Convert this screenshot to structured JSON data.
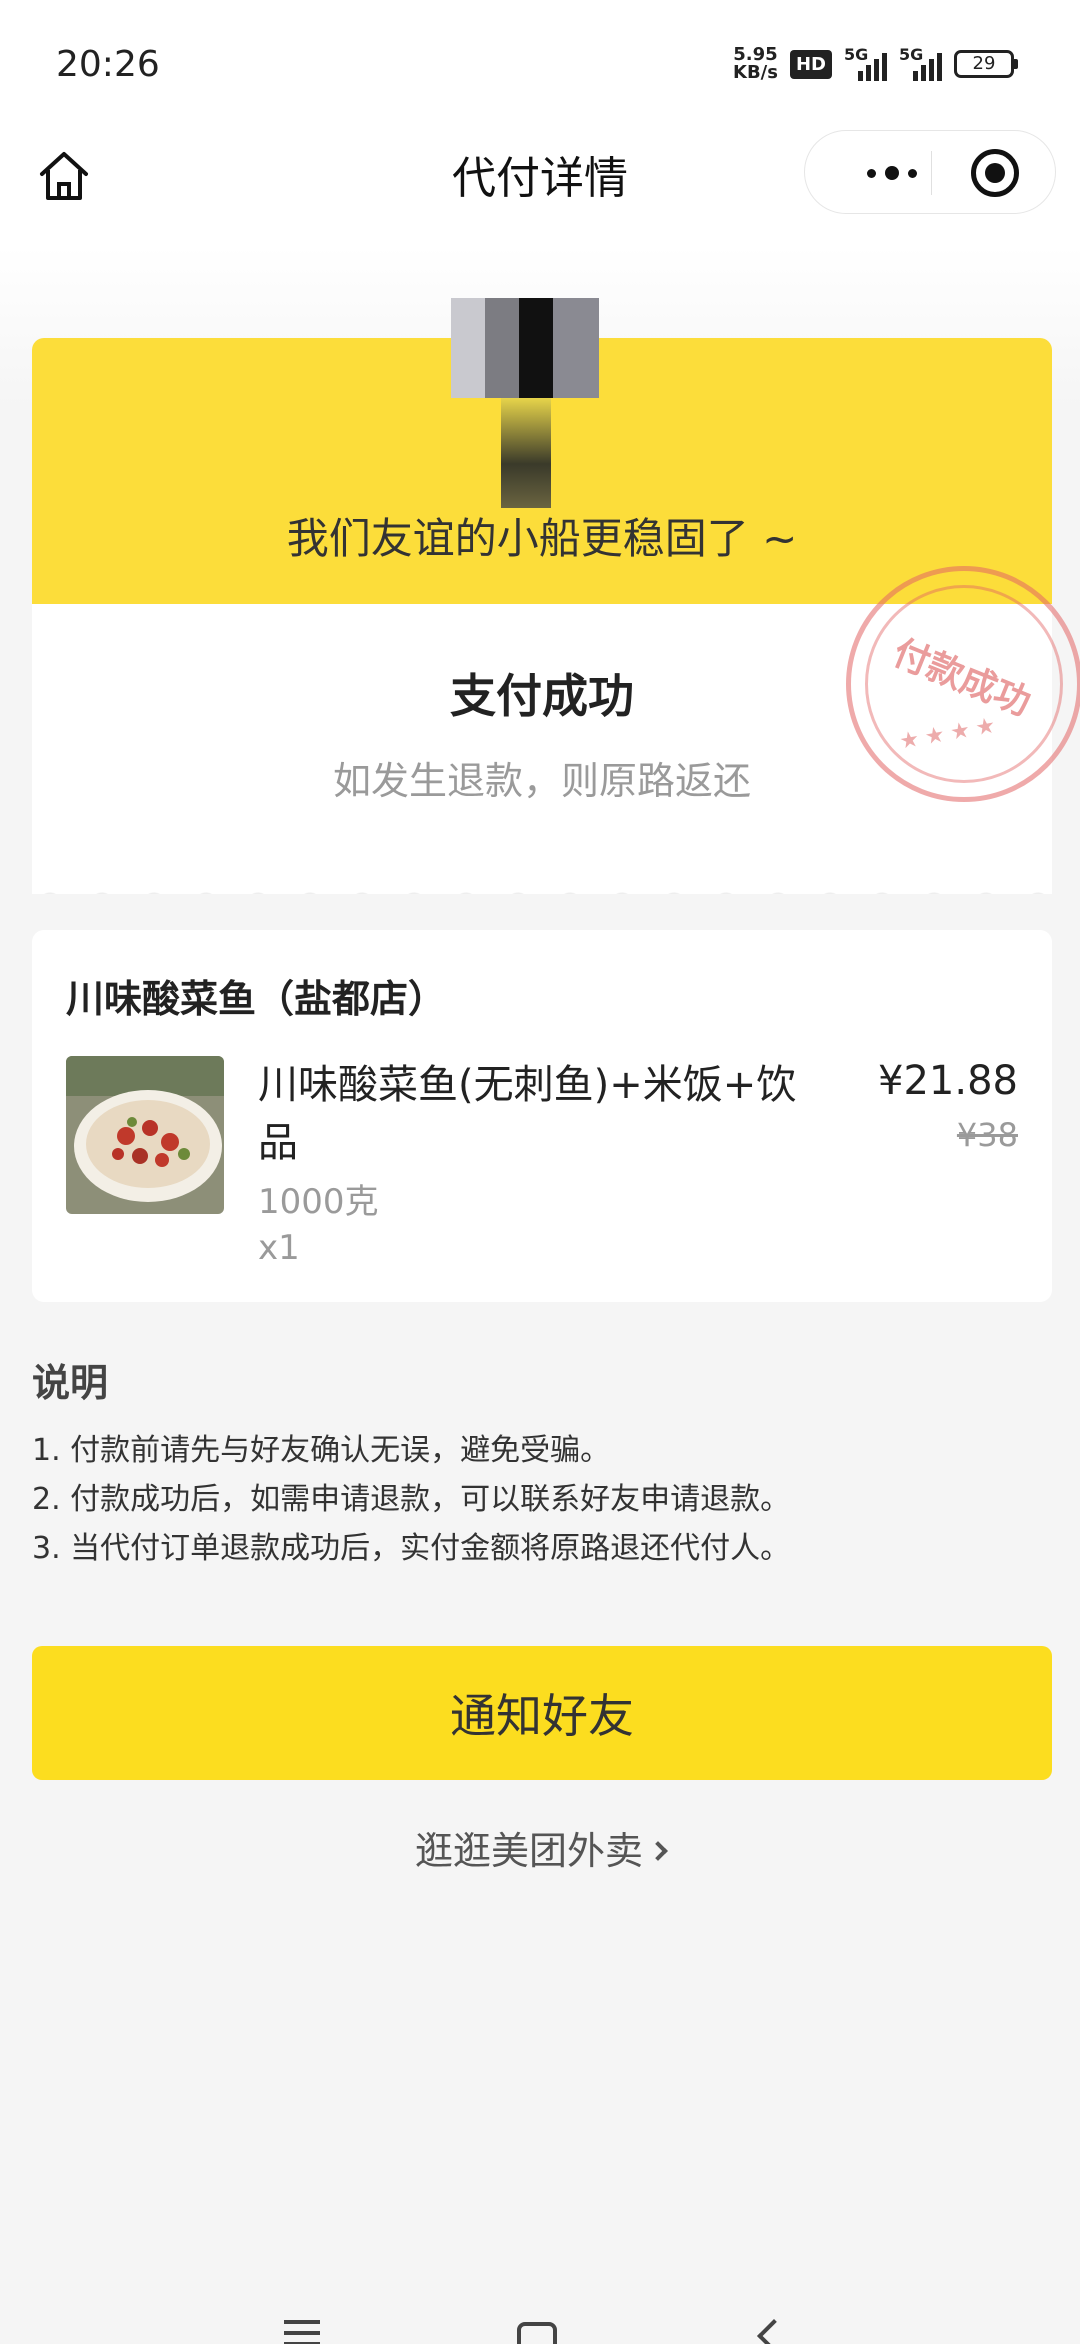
{
  "status_bar": {
    "time": "20:26",
    "net_speed_value": "5.95",
    "net_speed_unit": "KB/s",
    "hd_label": "HD",
    "sim1_label": "5G",
    "sim2_label": "5G",
    "battery": "29"
  },
  "nav": {
    "title": "代付详情",
    "home_icon": "home-icon",
    "more_icon": "more-dots-icon",
    "close_icon": "target-close-icon"
  },
  "success_card": {
    "message": "我们友谊的小船更稳固了 ~",
    "status": "支付成功",
    "note": "如发生退款，则原路返还",
    "stamp_text": "付款成功",
    "accent_color": "#fcdd3a"
  },
  "order": {
    "shop_name": "川味酸菜鱼（盐都店）",
    "items": [
      {
        "name": "川味酸菜鱼(无刺鱼)+米饭+饮品",
        "spec": "1000克",
        "quantity": "x1",
        "price": "¥21.88",
        "original_price": "¥38"
      }
    ]
  },
  "notes": {
    "title": "说明",
    "items": [
      "1. 付款前请先与好友确认无误，避免受骗。",
      "2. 付款成功后，如需申请退款，可以联系好友申请退款。",
      "3. 当代付订单退款成功后，实付金额将原路退还代付人。"
    ]
  },
  "actions": {
    "notify_label": "通知好友",
    "browse_label": "逛逛美团外卖",
    "button_color": "#fcdd1f"
  }
}
